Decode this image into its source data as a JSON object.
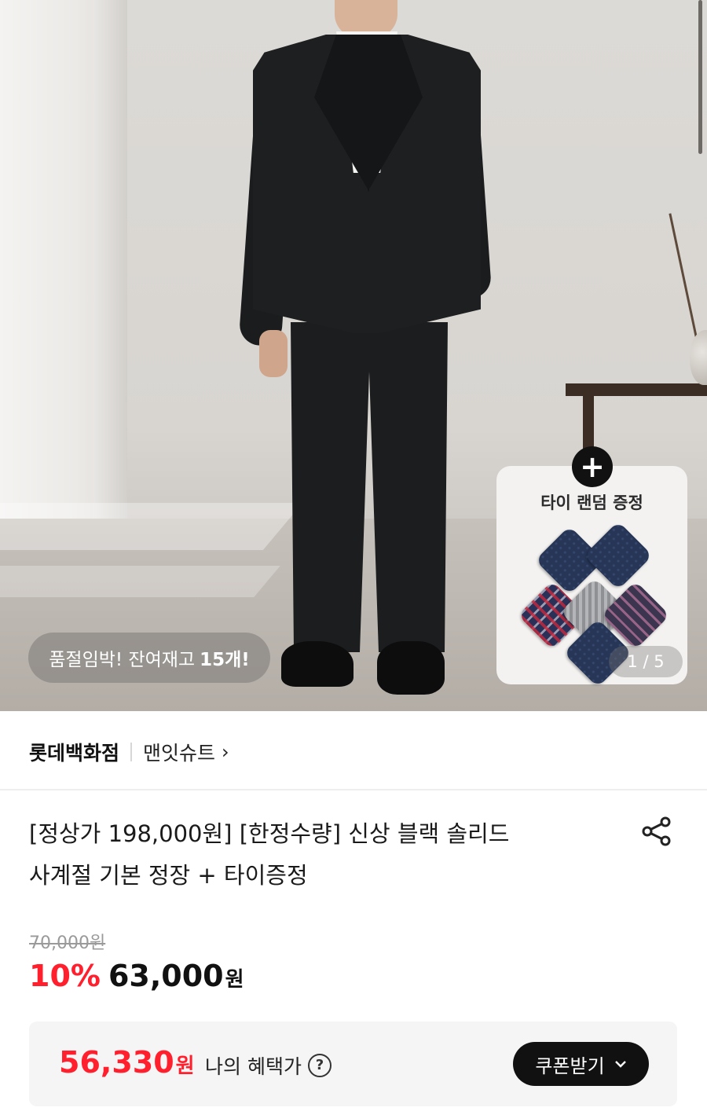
{
  "hero": {
    "stock_notice_prefix": "품절임박! 잔여재고",
    "stock_notice_count": "15개!",
    "gift_title": "타이 랜덤 증정",
    "gift_plus": "+",
    "page_counter": "1 / 5"
  },
  "store": {
    "name": "롯데백화점",
    "brand": "맨잇슈트",
    "brand_chevron": "›"
  },
  "product": {
    "title_line1": "[정상가 198,000원] [한정수량] 신상 블랙 솔리드",
    "title_line2": "사계절 기본 정장 + 타이증정"
  },
  "price": {
    "original": "70,000원",
    "discount_rate": "10%",
    "sale_amount": "63,000",
    "sale_unit": "원"
  },
  "benefit": {
    "amount": "56,330",
    "unit": "원",
    "label": "나의 혜택가",
    "help": "?",
    "coupon_label": "쿠폰받기",
    "coupon_chevron": "⌄"
  },
  "colors": {
    "accent_red": "#ff1f2d",
    "button_dark": "#111111"
  },
  "icons": [
    "share-icon",
    "help-icon",
    "plus-icon",
    "chevron-right-icon",
    "chevron-down-icon"
  ]
}
